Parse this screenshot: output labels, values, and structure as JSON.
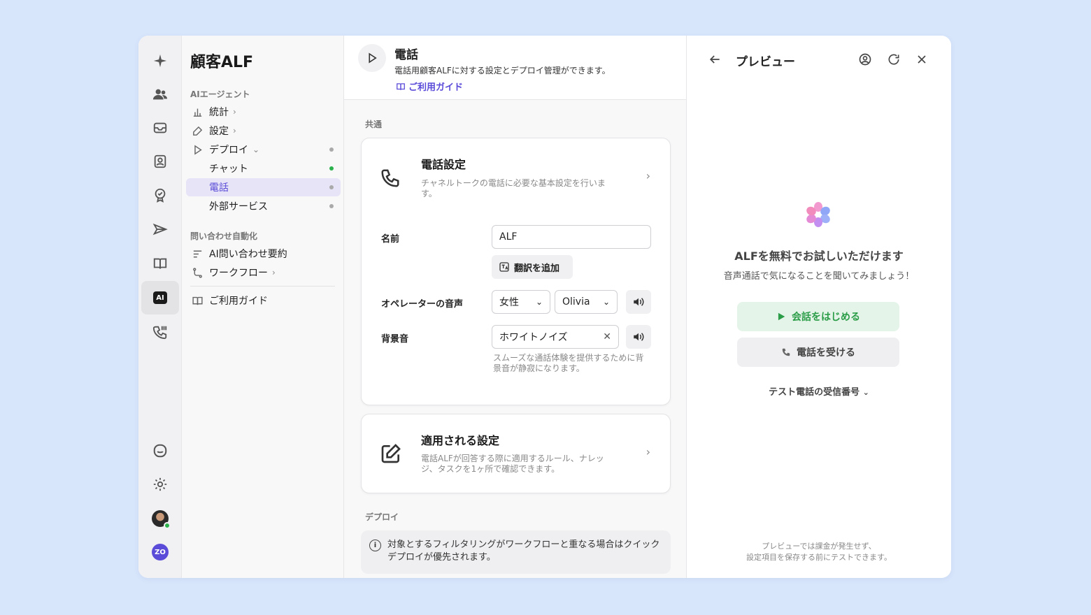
{
  "sidebar": {
    "title": "顧客ALF",
    "section_ai": "AIエージェント",
    "stats": "統計",
    "settings": "設定",
    "deploy": "デプロイ",
    "chat": "チャット",
    "phone": "電話",
    "external": "外部サービス",
    "section_auto": "問い合わせ自動化",
    "summary": "AI問い合わせ要約",
    "workflow": "ワークフロー",
    "guide": "ご利用ガイド"
  },
  "rail": {
    "ai_label": "AI",
    "zo_label": "ZO"
  },
  "header": {
    "title": "電話",
    "description": "電話用顧客ALFに対する設定とデプロイ管理ができます。",
    "guide_link": "ご利用ガイド"
  },
  "common": {
    "section": "共通",
    "phone_settings": {
      "title": "電話設定",
      "description": "チャネルトークの電話に必要な基本設定を行います。"
    },
    "name_label": "名前",
    "name_value": "ALF",
    "translate_button": "翻訳を追加",
    "voice_label": "オペレーターの音声",
    "voice_gender": "女性",
    "voice_name": "Olivia",
    "bg_label": "背景音",
    "bg_value": "ホワイトノイズ",
    "bg_helper": "スムーズな通話体験を提供するために背景音が静寂になります。",
    "applied": {
      "title": "適用される設定",
      "description": "電話ALFが回答する際に適用するルール、ナレッジ、タスクを1ヶ所で確認できます。"
    }
  },
  "deploy": {
    "section": "デプロイ",
    "info": "対象とするフィルタリングがワークフローと重なる場合はクイックデプロイが優先されます。"
  },
  "preview": {
    "title": "プレビュー",
    "heading": "ALFを無料でお試しいただけます",
    "subheading": "音声通話で気になることを聞いてみましょう！",
    "start_button": "会話をはじめる",
    "receive_button": "電話を受ける",
    "test_number": "テスト電話の受信番号",
    "footer_line1": "プレビューでは課金が発生せず、",
    "footer_line2": "設定項目を保存する前にテストできます。"
  }
}
